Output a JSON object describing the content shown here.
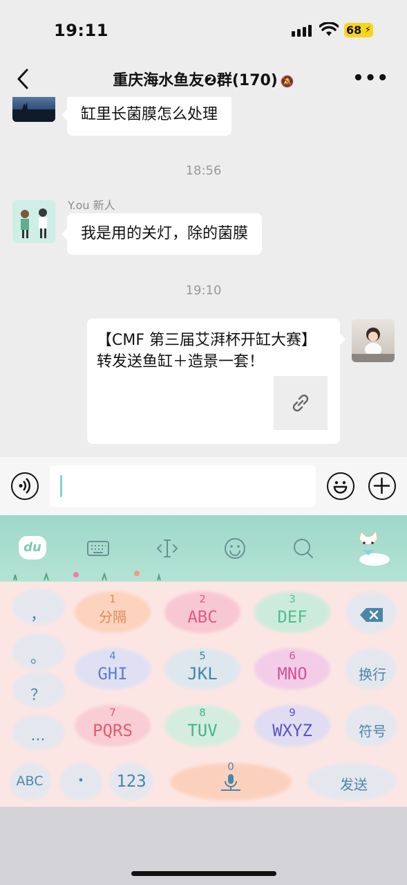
{
  "status": {
    "time": "19:11",
    "battery": "68"
  },
  "nav": {
    "title": "重庆海水鱼友❷群(170)"
  },
  "messages": [
    {
      "type": "text",
      "text": "缸里长菌膜怎么处理"
    },
    {
      "type": "timestamp",
      "text": "18:56"
    },
    {
      "type": "text",
      "sender": "Y.ou 新人",
      "text": "我是用的关灯，除的菌膜"
    },
    {
      "type": "timestamp",
      "text": "19:10"
    },
    {
      "type": "card",
      "text": "【CMF 第三届艾湃杯开缸大赛】转发送鱼缸＋造景一套！"
    }
  ],
  "keyboard": {
    "left_column": [
      "，",
      "。",
      "？",
      "..."
    ],
    "keys": [
      {
        "num": "1",
        "label": "分隔",
        "color": "#e0895a"
      },
      {
        "num": "2",
        "label": "ABC",
        "color": "#e45a7d"
      },
      {
        "num": "3",
        "label": "DEF",
        "color": "#4fbf8c"
      },
      {
        "num": "4",
        "label": "GHI",
        "color": "#5b7fcf"
      },
      {
        "num": "5",
        "label": "JKL",
        "color": "#3d87a6"
      },
      {
        "num": "6",
        "label": "MNO",
        "color": "#d4509a"
      },
      {
        "num": "7",
        "label": "PQRS",
        "color": "#e45a70"
      },
      {
        "num": "8",
        "label": "TUV",
        "color": "#3fb58e"
      },
      {
        "num": "9",
        "label": "WXYZ",
        "color": "#5a55c8"
      }
    ],
    "right_column": [
      "换行",
      "符号"
    ],
    "bottom_row": {
      "abc": "ABC",
      "dot": "•",
      "num": "123",
      "space_num": "0",
      "send": "发送"
    },
    "logo": "du"
  },
  "colors": {
    "accent_teal": "#9ed8c8",
    "keyboard_bg": "#fce6e4",
    "battery": "#f7d51b"
  }
}
